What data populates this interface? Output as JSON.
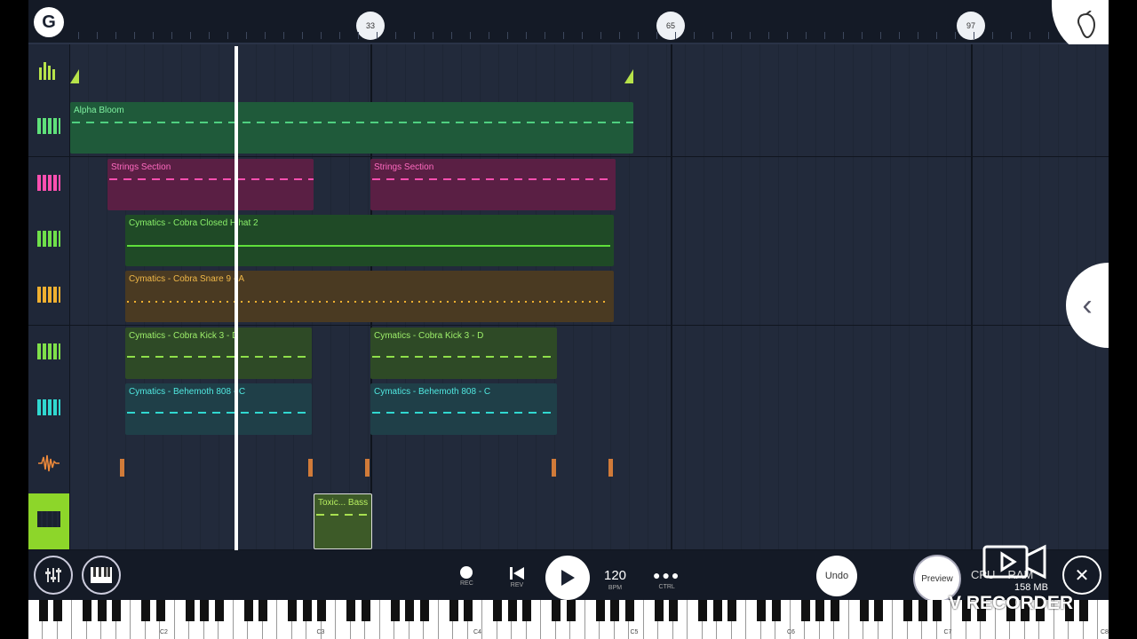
{
  "ruler": {
    "markers": [
      "33",
      "65",
      "97"
    ]
  },
  "tracks": [
    {
      "id": "automation",
      "icon": "eq-bars-icon",
      "icon_color": "#b7e34a",
      "clips": []
    },
    {
      "id": "alpha-bloom",
      "icon": "piano-icon",
      "icon_color": "#5fe07a",
      "clips": [
        {
          "label": "Alpha Bloom",
          "color": "#1f5a3a",
          "text": "#7ef0a0",
          "note": "#4fd080"
        }
      ]
    },
    {
      "id": "strings",
      "icon": "piano-icon",
      "icon_color": "#ff4fb0",
      "clips": [
        {
          "label": "Strings Section",
          "color": "#5a1f44",
          "text": "#ff6ac0",
          "note": "#ff4fb0"
        },
        {
          "label": "Strings Section",
          "color": "#5a1f44",
          "text": "#ff6ac0",
          "note": "#ff4fb0"
        }
      ]
    },
    {
      "id": "closed-hihat",
      "icon": "piano-icon",
      "icon_color": "#6fe04a",
      "clips": [
        {
          "label": "Cymatics - Cobra Closed Hihat 2",
          "color": "#1f4a26",
          "text": "#8af06a",
          "note": "#5fdf3a"
        }
      ]
    },
    {
      "id": "snare",
      "icon": "piano-icon",
      "icon_color": "#f0b030",
      "clips": [
        {
          "label": "Cymatics - Cobra Snare 9 - A",
          "color": "#4a3a22",
          "text": "#f0b848",
          "note": "#f0b030"
        }
      ]
    },
    {
      "id": "kick",
      "icon": "piano-icon",
      "icon_color": "#7fe04a",
      "clips": [
        {
          "label": "Cymatics - Cobra Kick 3 - D",
          "color": "#2e4a26",
          "text": "#9ef06a",
          "note": "#8fdf4a"
        },
        {
          "label": "Cymatics - Cobra Kick 3 - D",
          "color": "#2e4a26",
          "text": "#9ef06a",
          "note": "#8fdf4a"
        }
      ]
    },
    {
      "id": "808",
      "icon": "piano-icon",
      "icon_color": "#30d8d0",
      "clips": [
        {
          "label": "Cymatics - Behemoth 808 - C",
          "color": "#1f3f48",
          "text": "#50e8e0",
          "note": "#30d8d0"
        },
        {
          "label": "Cymatics - Behemoth 808 - C",
          "color": "#1f3f48",
          "text": "#50e8e0",
          "note": "#30d8d0"
        }
      ]
    },
    {
      "id": "audio",
      "icon": "waveform-icon",
      "icon_color": "#f08a3a",
      "clips": []
    },
    {
      "id": "toxic-bass",
      "icon": "piano-icon",
      "icon_color": "#1a2130",
      "clips": [
        {
          "label": "Toxic... Bass",
          "color": "#3d5a28",
          "text": "#b8f060",
          "note": "#a8e050"
        }
      ]
    }
  ],
  "toolbar": {
    "rec_label": "REC",
    "rev_label": "REV",
    "bpm_value": "120",
    "bpm_label": "BPM",
    "ctrl_label": "CTRL",
    "undo_label": "Undo",
    "preview_label": "Preview",
    "cpu_label": "CPU",
    "ram_label": "RAM",
    "memory_value": "158 MB"
  },
  "keyboard": {
    "labels": [
      "C2",
      "C3",
      "C4",
      "C5",
      "C6",
      "C7",
      "C8"
    ]
  },
  "watermark": {
    "text": "V RECORDER"
  }
}
